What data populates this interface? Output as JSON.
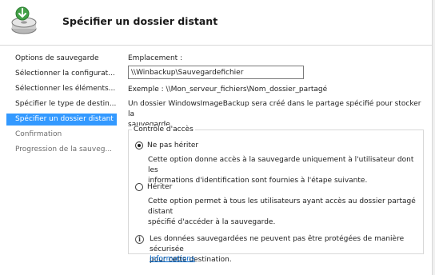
{
  "header": {
    "title": "Spécifier un dossier distant",
    "icon": "backup-disk-icon"
  },
  "sidebar": {
    "items": [
      {
        "label": "Options de sauvegarde",
        "state": "normal"
      },
      {
        "label": "Sélectionner la configurat...",
        "state": "normal"
      },
      {
        "label": "Sélectionner les éléments...",
        "state": "normal"
      },
      {
        "label": "Spécifier le type de destin...",
        "state": "normal"
      },
      {
        "label": "Spécifier un dossier distant",
        "state": "selected"
      },
      {
        "label": "Confirmation",
        "state": "disabled"
      },
      {
        "label": "Progression de la sauveg...",
        "state": "disabled"
      }
    ]
  },
  "main": {
    "location_label": "Emplacement :",
    "location_value": "\\\\Winbackup\\Sauvegardefichier",
    "example": "Exemple : \\\\Mon_serveur_fichiers\\Nom_dossier_partagé",
    "info_line1": "Un dossier WindowsImageBackup sera créé dans le partage spécifié pour stocker la",
    "info_line2": "sauvegarde.",
    "access_group": {
      "title": "Contrôle d'accès",
      "options": [
        {
          "label": "Ne pas hériter",
          "checked": true,
          "desc_line1": "Cette option donne accès à la sauvegarde uniquement à l'utilisateur dont les",
          "desc_line2": "informations d'identification sont fournies à l'étape suivante."
        },
        {
          "label": "Hériter",
          "checked": false,
          "desc_line1": "Cette option permet à tous les utilisateurs ayant accès au dossier partagé distant",
          "desc_line2": "spécifié d'accéder à la sauvegarde."
        }
      ]
    },
    "notice_line1": "Les données sauvegardées ne peuvent pas être protégées de manière sécurisée",
    "notice_line2": "pour cette destination.",
    "link": "Informations",
    "colors": {
      "selected_bg": "#3399ff",
      "link": "#0066cc"
    }
  }
}
